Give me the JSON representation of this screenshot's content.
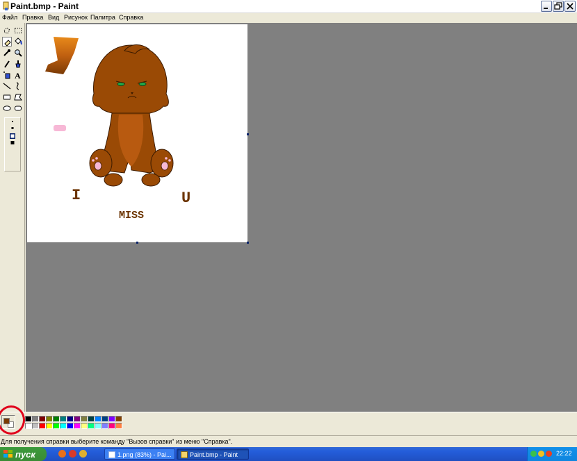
{
  "window": {
    "title": "Paint.bmp - Paint"
  },
  "menu": {
    "items": [
      "Файл",
      "Правка",
      "Вид",
      "Рисунок",
      "Палитра",
      "Справка"
    ]
  },
  "toolbox": {
    "tools": [
      {
        "name": "free-select-icon",
        "selected": false
      },
      {
        "name": "rect-select-icon",
        "selected": false
      },
      {
        "name": "eraser-icon",
        "selected": true
      },
      {
        "name": "fill-icon",
        "selected": false
      },
      {
        "name": "color-picker-icon",
        "selected": false
      },
      {
        "name": "magnifier-icon",
        "selected": false
      },
      {
        "name": "pencil-icon",
        "selected": false
      },
      {
        "name": "brush-icon",
        "selected": false
      },
      {
        "name": "airbrush-icon",
        "selected": false
      },
      {
        "name": "text-icon",
        "selected": false
      },
      {
        "name": "line-icon",
        "selected": false
      },
      {
        "name": "curve-icon",
        "selected": false
      },
      {
        "name": "rectangle-icon",
        "selected": false
      },
      {
        "name": "polygon-icon",
        "selected": false
      },
      {
        "name": "ellipse-icon",
        "selected": false
      },
      {
        "name": "rounded-rect-icon",
        "selected": false
      }
    ]
  },
  "canvas": {
    "texts": [
      "I",
      "U",
      "MISS"
    ],
    "colors": {
      "fur": "#9a4a05",
      "fur_light": "#b85a10",
      "outline": "#3a1a00",
      "eyes": "#1fa84a",
      "pink": "#f7b8d6",
      "text": "#6b3300"
    }
  },
  "palette": {
    "foreground": "#7a3a00",
    "background": "#ffffff",
    "row1": [
      "#000000",
      "#808080",
      "#800000",
      "#808000",
      "#008000",
      "#008080",
      "#000080",
      "#800080",
      "#808040",
      "#004040",
      "#0080ff",
      "#004080",
      "#8000ff",
      "#804000"
    ],
    "row2": [
      "#ffffff",
      "#c0c0c0",
      "#ff0000",
      "#ffff00",
      "#00ff00",
      "#00ffff",
      "#0000ff",
      "#ff00ff",
      "#ffff80",
      "#00ff80",
      "#80ffff",
      "#8080ff",
      "#ff0080",
      "#ff8040"
    ]
  },
  "status": {
    "help_text": "Для получения справки выберите команду \"Вызов справки\" из меню \"Справка\"."
  },
  "taskbar": {
    "start_label": "пуск",
    "tasks": [
      "1.png (83%) - Pai...",
      "Paint.bmp - Paint"
    ],
    "clock": "22:22"
  }
}
